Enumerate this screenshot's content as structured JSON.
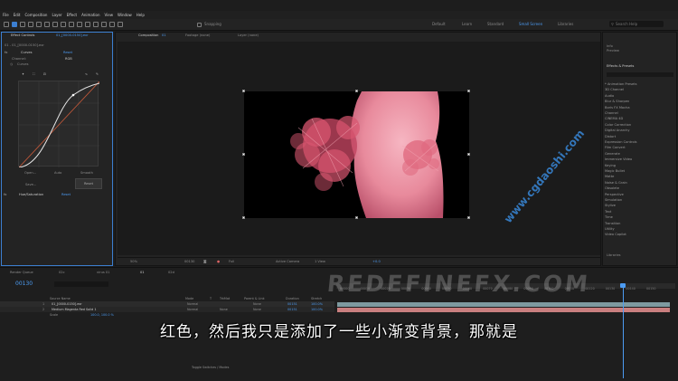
{
  "menu": [
    "File",
    "Edit",
    "Composition",
    "Layer",
    "Effect",
    "Animation",
    "View",
    "Window",
    "Help"
  ],
  "toolbar": {
    "snapping": "Snapping",
    "workspaces": [
      "Default",
      "Learn",
      "Standard",
      "Small Screen",
      "Libraries"
    ],
    "active_workspace": "Small Screen",
    "search_placeholder": "Search Help"
  },
  "effect_controls": {
    "tab_label": "Effect Controls",
    "tab_file": "01_[0000-0150].exr",
    "header": "01 - 01_[0000-0150].exr",
    "curves": {
      "name": "Curves",
      "reset": "Reset",
      "channel_label": "Channel:",
      "channel_value": "RGB",
      "sub_label": "Curves"
    },
    "curve_buttons": [
      "Open...",
      "Auto",
      "Smooth",
      "Save...",
      "Reset"
    ],
    "hue": {
      "name": "Hue/Saturation",
      "reset": "Reset"
    }
  },
  "composition": {
    "tab_label": "Composition",
    "tab_name": "01",
    "footage_tab": "Footage (none)",
    "layer_tab": "Layer (none)",
    "breadcrumb": "01"
  },
  "viewer_bar": {
    "zoom": "50%",
    "time": "00130",
    "resolution": "Full",
    "camera": "Active Camera",
    "views": "1 View",
    "exposure": "+0.0"
  },
  "right_panel": {
    "info": "Info",
    "preview": "Preview",
    "effects_title": "Effects & Presets",
    "effects": [
      "* Animation Presets",
      "3D Channel",
      "Audio",
      "Blur & Sharpen",
      "Boris FX Mocha",
      "Channel",
      "CINEMA 4D",
      "Color Correction",
      "Digital Anarchy",
      "Distort",
      "Expression Controls",
      "Film Convert",
      "Generate",
      "Immersive Video",
      "Keying",
      "Magic Bullet",
      "Matte",
      "Noise & Grain",
      "Obsolete",
      "Perspective",
      "Simulation",
      "Stylize",
      "Text",
      "Time",
      "Transition",
      "Utility",
      "Video Copilot"
    ],
    "libraries": "Libraries"
  },
  "timeline": {
    "tabs": [
      "Render Queue",
      "02c",
      "virus 01",
      "01",
      "02d"
    ],
    "timecode": "00130",
    "columns": [
      "Source Name",
      "Mode",
      "T",
      "TrkMat",
      "Parent & Link",
      "Duration",
      "Stretch"
    ],
    "layers": [
      {
        "num": "1",
        "name": "01_[0000-0150].exr",
        "mode": "Normal",
        "parent": "None",
        "duration": "00151",
        "stretch": "100.0%"
      },
      {
        "num": "2",
        "name": "Medium Magenta Red Solid 1",
        "mode": "Normal",
        "trkmat": "None",
        "parent": "None",
        "duration": "00151",
        "stretch": "100.0%"
      }
    ],
    "sub_property": "Scale",
    "sub_value": "100.0, 100.0 %",
    "ticks": [
      "00000",
      "00010",
      "00020",
      "00030",
      "00040",
      "00050",
      "00060",
      "00070",
      "00080",
      "00090",
      "00100",
      "00110",
      "00120",
      "00130",
      "00140",
      "00150"
    ],
    "toggle": "Toggle Switches / Modes"
  },
  "overlay": {
    "subtitle": "红色，然后我只是添加了一些小渐变背景，那就是",
    "watermark_main": "REDEFINEFX.COM",
    "watermark_diag": "www.cgdaoshi.com"
  },
  "colors": {
    "accent_blue": "#4c9bf2",
    "track_layer1": "#7e9aa0",
    "track_layer2": "#c97f7f",
    "subject_pink": "#e88a9c"
  }
}
